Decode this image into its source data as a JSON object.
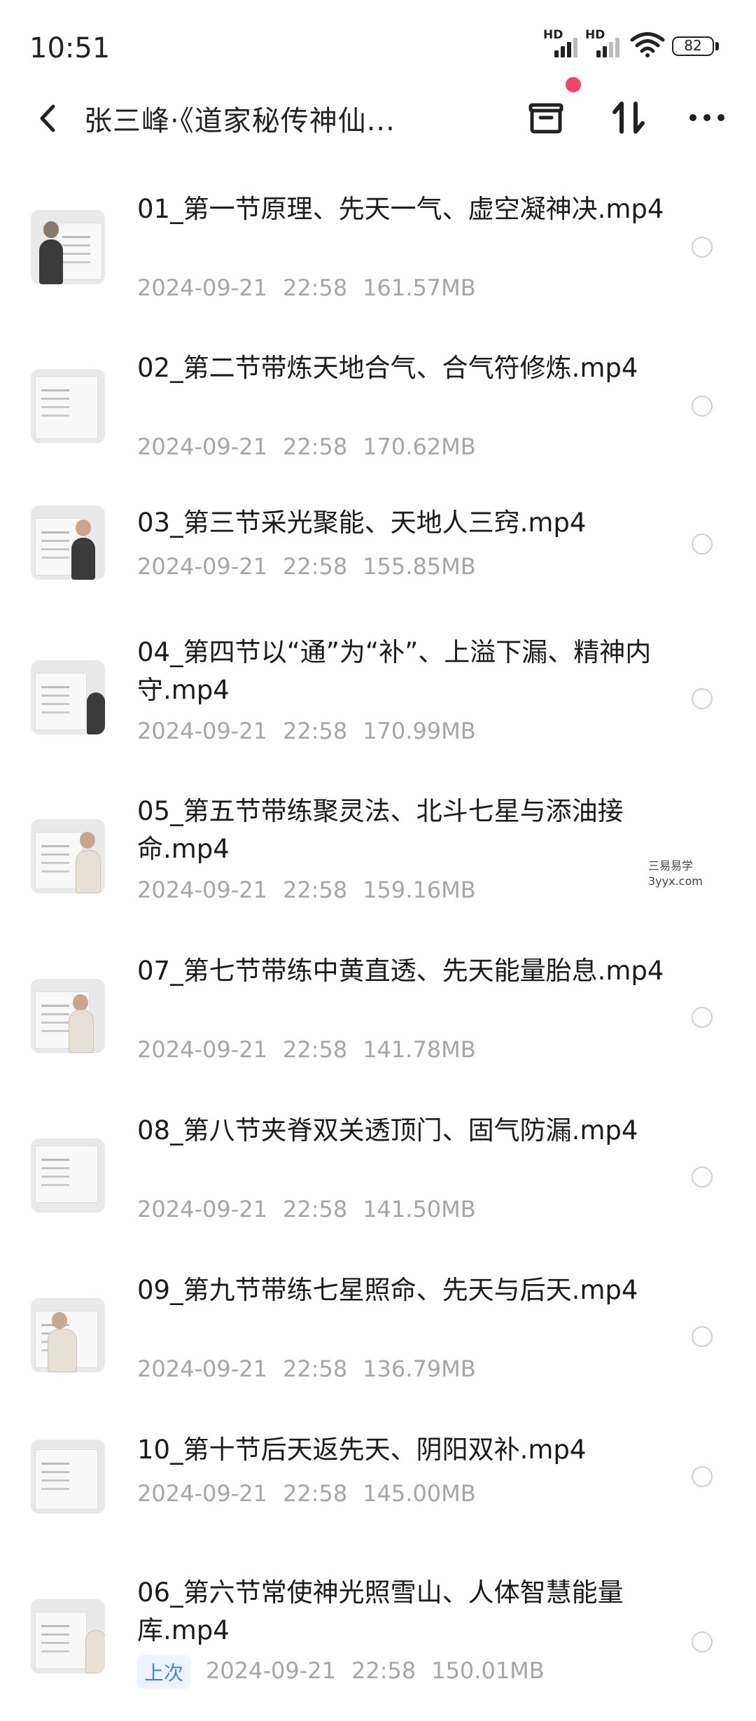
{
  "status_bar": {
    "time": "10:51",
    "signal1_label": "HD",
    "signal2_label": "HD",
    "battery": "82"
  },
  "header": {
    "title": "张三峰·《道家秘传神仙...",
    "icons": [
      "back-arrow-icon",
      "archive-icon",
      "sort-icon",
      "more-icon"
    ],
    "notification_dot_color": "#f0466b"
  },
  "files": [
    {
      "name": "01_第一节原理、先天一气、虚空凝神决.mp4",
      "date": "2024-09-21",
      "time": "22:58",
      "size": "161.57MB"
    },
    {
      "name": "02_第二节带炼天地合气、合气符修炼.mp4",
      "date": "2024-09-21",
      "time": "22:58",
      "size": "170.62MB"
    },
    {
      "name": "03_第三节采光聚能、天地人三窍.mp4",
      "date": "2024-09-21",
      "time": "22:58",
      "size": "155.85MB"
    },
    {
      "name": "04_第四节以“通”为“补”、上溢下漏、精神内守.mp4",
      "date": "2024-09-21",
      "time": "22:58",
      "size": "170.99MB"
    },
    {
      "name": "05_第五节带练聚灵法、北斗七星与添油接命.mp4",
      "date": "2024-09-21",
      "time": "22:58",
      "size": "159.16MB"
    },
    {
      "name": "07_第七节带练中黄直透、先天能量胎息.mp4",
      "date": "2024-09-21",
      "time": "22:58",
      "size": "141.78MB"
    },
    {
      "name": "08_第八节夹脊双关透顶门、固气防漏.mp4",
      "date": "2024-09-21",
      "time": "22:58",
      "size": "141.50MB"
    },
    {
      "name": "09_第九节带练七星照命、先天与后天.mp4",
      "date": "2024-09-21",
      "time": "22:58",
      "size": "136.79MB"
    },
    {
      "name": "10_第十节后天返先天、阴阳双补.mp4",
      "date": "2024-09-21",
      "time": "22:58",
      "size": "145.00MB"
    },
    {
      "name": "06_第六节常使神光照雪山、人体智慧能量库.mp4",
      "date": "2024-09-21",
      "time": "22:58",
      "size": "150.01MB",
      "tag": "上次"
    }
  ],
  "watermark": {
    "line1": "三易易学",
    "line2": "3yyx.com"
  },
  "accent_color": "#3b82f6"
}
